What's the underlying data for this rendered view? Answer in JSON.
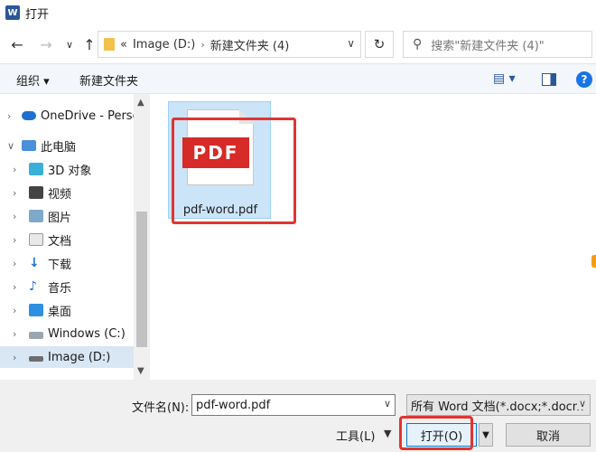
{
  "window": {
    "title": "打开"
  },
  "nav": {
    "path_prefix": "«",
    "crumbs": [
      "Image (D:)",
      "新建文件夹 (4)"
    ],
    "search_placeholder": "搜索\"新建文件夹 (4)\""
  },
  "toolbar": {
    "organize": "组织 ▾",
    "new_folder": "新建文件夹"
  },
  "sidebar": {
    "items": [
      {
        "label": "OneDrive - Persc",
        "icon": "cloud-icon"
      },
      {
        "label": "此电脑",
        "icon": "computer-icon"
      },
      {
        "label": "3D 对象",
        "icon": "cube-icon"
      },
      {
        "label": "视频",
        "icon": "video-icon"
      },
      {
        "label": "图片",
        "icon": "picture-icon"
      },
      {
        "label": "文档",
        "icon": "document-icon"
      },
      {
        "label": "下载",
        "icon": "download-icon"
      },
      {
        "label": "音乐",
        "icon": "music-icon"
      },
      {
        "label": "桌面",
        "icon": "desktop-icon"
      },
      {
        "label": "Windows  (C:)",
        "icon": "drive-icon"
      },
      {
        "label": "Image (D:)",
        "icon": "drive-icon"
      }
    ]
  },
  "files": [
    {
      "name": "pdf-word.pdf",
      "badge": "PDF",
      "icon": "pdf-file-icon"
    }
  ],
  "footer": {
    "filename_label": "文件名(N):",
    "filename_value": "pdf-word.pdf",
    "filetype_value": "所有 Word 文档(*.docx;*.docm",
    "tools_label": "工具(L)",
    "open_label": "打开(O)",
    "cancel_label": "取消"
  }
}
